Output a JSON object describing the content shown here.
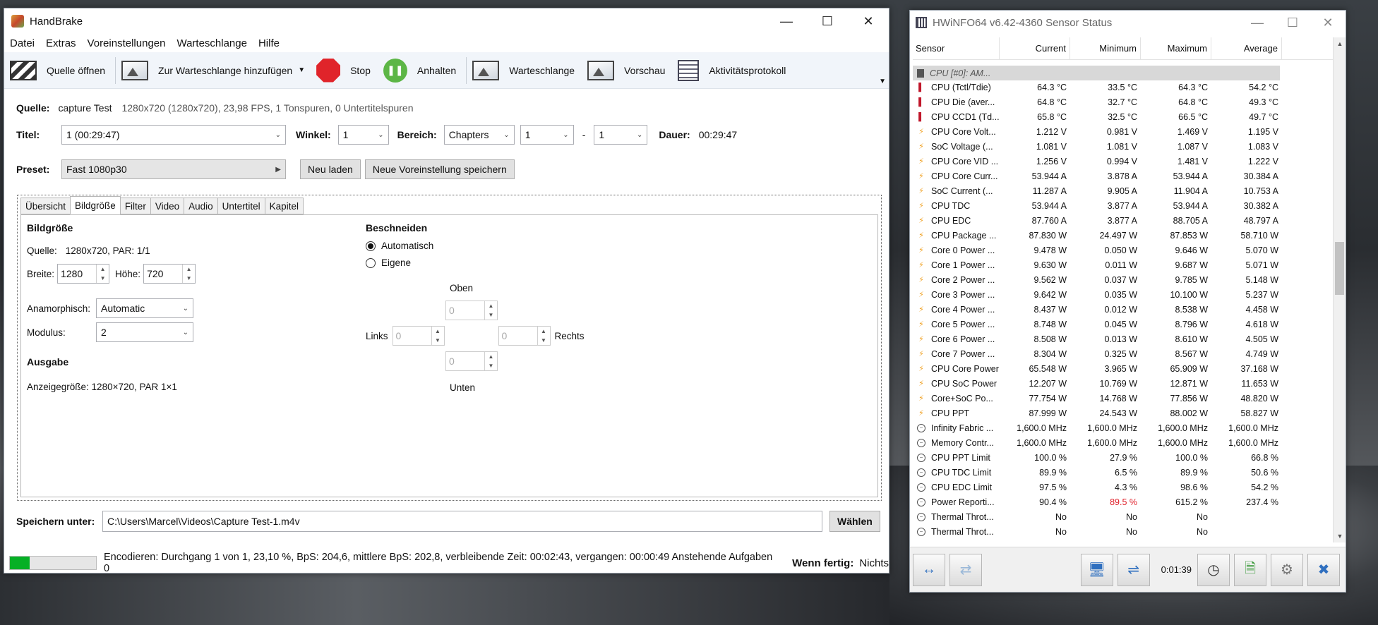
{
  "handbrake": {
    "title": "HandBrake",
    "menu": [
      "Datei",
      "Extras",
      "Voreinstellungen",
      "Warteschlange",
      "Hilfe"
    ],
    "toolbar": {
      "open_source": "Quelle öffnen",
      "add_queue": "Zur Warteschlange hinzufügen",
      "stop": "Stop",
      "pause": "Anhalten",
      "queue": "Warteschlange",
      "preview": "Vorschau",
      "activity_log": "Aktivitätsprotokoll"
    },
    "source": {
      "label": "Quelle:",
      "name": "capture Test",
      "info": "1280x720 (1280x720), 23,98 FPS, 1 Tonspuren, 0 Untertitelspuren"
    },
    "title_row": {
      "title_label": "Titel:",
      "title_value": "1  (00:29:47)",
      "angle_label": "Winkel:",
      "angle_value": "1",
      "range_label": "Bereich:",
      "range_type": "Chapters",
      "range_from": "1",
      "range_sep": "-",
      "range_to": "1",
      "duration_label": "Dauer:",
      "duration_value": "00:29:47"
    },
    "preset": {
      "label": "Preset:",
      "value": "Fast 1080p30",
      "reload": "Neu laden",
      "save_new": "Neue Voreinstellung speichern"
    },
    "tabs": [
      "Übersicht",
      "Bildgröße",
      "Filter",
      "Video",
      "Audio",
      "Untertitel",
      "Kapitel"
    ],
    "picture": {
      "heading": "Bildgröße",
      "source_label": "Quelle:",
      "source_value": "1280x720, PAR: 1/1",
      "width_label": "Breite:",
      "width_value": "1280",
      "height_label": "Höhe:",
      "height_value": "720",
      "anamorphic_label": "Anamorphisch:",
      "anamorphic_value": "Automatic",
      "modulus_label": "Modulus:",
      "modulus_value": "2",
      "output_heading": "Ausgabe",
      "display_size": "Anzeigegröße: 1280×720,  PAR 1×1"
    },
    "crop": {
      "heading": "Beschneiden",
      "auto": "Automatisch",
      "custom": "Eigene",
      "top_label": "Oben",
      "top_value": "0",
      "left_label": "Links",
      "left_value": "0",
      "right_value": "0",
      "right_label": "Rechts",
      "bottom_value": "0",
      "bottom_label": "Unten"
    },
    "save": {
      "label": "Speichern unter:",
      "path": "C:\\Users\\Marcel\\Videos\\Capture Test-1.m4v",
      "browse": "Wählen"
    },
    "status": {
      "progress": 0.231,
      "text": "Encodieren: Durchgang 1 von 1,  23,10 %, BpS: 204,6, mittlere BpS: 202,8, verbleibende Zeit: 00:02:43, vergangen: 00:00:49 Anstehende Aufgaben 0",
      "when_done_label": "Wenn fertig:",
      "when_done_value": "Nichts"
    }
  },
  "hwinfo": {
    "title": "HWiNFO64 v6.42-4360 Sensor Status",
    "columns": [
      "Sensor",
      "Current",
      "Minimum",
      "Maximum",
      "Average"
    ],
    "group": "CPU [#0]: AM...",
    "rows": [
      {
        "icon": "temp",
        "name": "CPU (Tctl/Tdie)",
        "cur": "64.3 °C",
        "min": "33.5 °C",
        "max": "64.3 °C",
        "avg": "54.2 °C"
      },
      {
        "icon": "temp",
        "name": "CPU Die (aver...",
        "cur": "64.8 °C",
        "min": "32.7 °C",
        "max": "64.8 °C",
        "avg": "49.3 °C"
      },
      {
        "icon": "temp",
        "name": "CPU CCD1 (Td...",
        "cur": "65.8 °C",
        "min": "32.5 °C",
        "max": "66.5 °C",
        "avg": "49.7 °C"
      },
      {
        "icon": "volt",
        "name": "CPU Core Volt...",
        "cur": "1.212 V",
        "min": "0.981 V",
        "max": "1.469 V",
        "avg": "1.195 V"
      },
      {
        "icon": "volt",
        "name": "SoC Voltage (...",
        "cur": "1.081 V",
        "min": "1.081 V",
        "max": "1.087 V",
        "avg": "1.083 V"
      },
      {
        "icon": "volt",
        "name": "CPU Core VID ...",
        "cur": "1.256 V",
        "min": "0.994 V",
        "max": "1.481 V",
        "avg": "1.222 V"
      },
      {
        "icon": "volt",
        "name": "CPU Core Curr...",
        "cur": "53.944 A",
        "min": "3.878 A",
        "max": "53.944 A",
        "avg": "30.384 A"
      },
      {
        "icon": "volt",
        "name": "SoC Current (...",
        "cur": "11.287 A",
        "min": "9.905 A",
        "max": "11.904 A",
        "avg": "10.753 A"
      },
      {
        "icon": "volt",
        "name": "CPU TDC",
        "cur": "53.944 A",
        "min": "3.877 A",
        "max": "53.944 A",
        "avg": "30.382 A"
      },
      {
        "icon": "volt",
        "name": "CPU EDC",
        "cur": "87.760 A",
        "min": "3.877 A",
        "max": "88.705 A",
        "avg": "48.797 A"
      },
      {
        "icon": "volt",
        "name": "CPU Package ...",
        "cur": "87.830 W",
        "min": "24.497 W",
        "max": "87.853 W",
        "avg": "58.710 W"
      },
      {
        "icon": "volt",
        "name": "Core 0 Power ...",
        "cur": "9.478 W",
        "min": "0.050 W",
        "max": "9.646 W",
        "avg": "5.070 W"
      },
      {
        "icon": "volt",
        "name": "Core 1 Power ...",
        "cur": "9.630 W",
        "min": "0.011 W",
        "max": "9.687 W",
        "avg": "5.071 W"
      },
      {
        "icon": "volt",
        "name": "Core 2 Power ...",
        "cur": "9.562 W",
        "min": "0.037 W",
        "max": "9.785 W",
        "avg": "5.148 W"
      },
      {
        "icon": "volt",
        "name": "Core 3 Power ...",
        "cur": "9.642 W",
        "min": "0.035 W",
        "max": "10.100 W",
        "avg": "5.237 W"
      },
      {
        "icon": "volt",
        "name": "Core 4 Power ...",
        "cur": "8.437 W",
        "min": "0.012 W",
        "max": "8.538 W",
        "avg": "4.458 W"
      },
      {
        "icon": "volt",
        "name": "Core 5 Power ...",
        "cur": "8.748 W",
        "min": "0.045 W",
        "max": "8.796 W",
        "avg": "4.618 W"
      },
      {
        "icon": "volt",
        "name": "Core 6 Power ...",
        "cur": "8.508 W",
        "min": "0.013 W",
        "max": "8.610 W",
        "avg": "4.505 W"
      },
      {
        "icon": "volt",
        "name": "Core 7 Power ...",
        "cur": "8.304 W",
        "min": "0.325 W",
        "max": "8.567 W",
        "avg": "4.749 W"
      },
      {
        "icon": "volt",
        "name": "CPU Core Power",
        "cur": "65.548 W",
        "min": "3.965 W",
        "max": "65.909 W",
        "avg": "37.168 W"
      },
      {
        "icon": "volt",
        "name": "CPU SoC Power",
        "cur": "12.207 W",
        "min": "10.769 W",
        "max": "12.871 W",
        "avg": "11.653 W"
      },
      {
        "icon": "volt",
        "name": "Core+SoC Po...",
        "cur": "77.754 W",
        "min": "14.768 W",
        "max": "77.856 W",
        "avg": "48.820 W"
      },
      {
        "icon": "volt",
        "name": "CPU PPT",
        "cur": "87.999 W",
        "min": "24.543 W",
        "max": "88.002 W",
        "avg": "58.827 W"
      },
      {
        "icon": "clock",
        "name": "Infinity Fabric ...",
        "cur": "1,600.0 MHz",
        "min": "1,600.0 MHz",
        "max": "1,600.0 MHz",
        "avg": "1,600.0 MHz"
      },
      {
        "icon": "clock",
        "name": "Memory Contr...",
        "cur": "1,600.0 MHz",
        "min": "1,600.0 MHz",
        "max": "1,600.0 MHz",
        "avg": "1,600.0 MHz"
      },
      {
        "icon": "clock",
        "name": "CPU PPT Limit",
        "cur": "100.0 %",
        "min": "27.9 %",
        "max": "100.0 %",
        "avg": "66.8 %"
      },
      {
        "icon": "clock",
        "name": "CPU TDC Limit",
        "cur": "89.9 %",
        "min": "6.5 %",
        "max": "89.9 %",
        "avg": "50.6 %"
      },
      {
        "icon": "clock",
        "name": "CPU EDC Limit",
        "cur": "97.5 %",
        "min": "4.3 %",
        "max": "98.6 %",
        "avg": "54.2 %"
      },
      {
        "icon": "clock",
        "name": "Power Reporti...",
        "cur": "90.4 %",
        "min": "89.5 %",
        "max": "615.2 %",
        "avg": "237.4 %",
        "min_red": true
      },
      {
        "icon": "clock",
        "name": "Thermal Throt...",
        "cur": "No",
        "min": "No",
        "max": "No",
        "avg": ""
      },
      {
        "icon": "clock",
        "name": "Thermal Throt...",
        "cur": "No",
        "min": "No",
        "max": "No",
        "avg": ""
      }
    ],
    "timer": "0:01:39"
  }
}
